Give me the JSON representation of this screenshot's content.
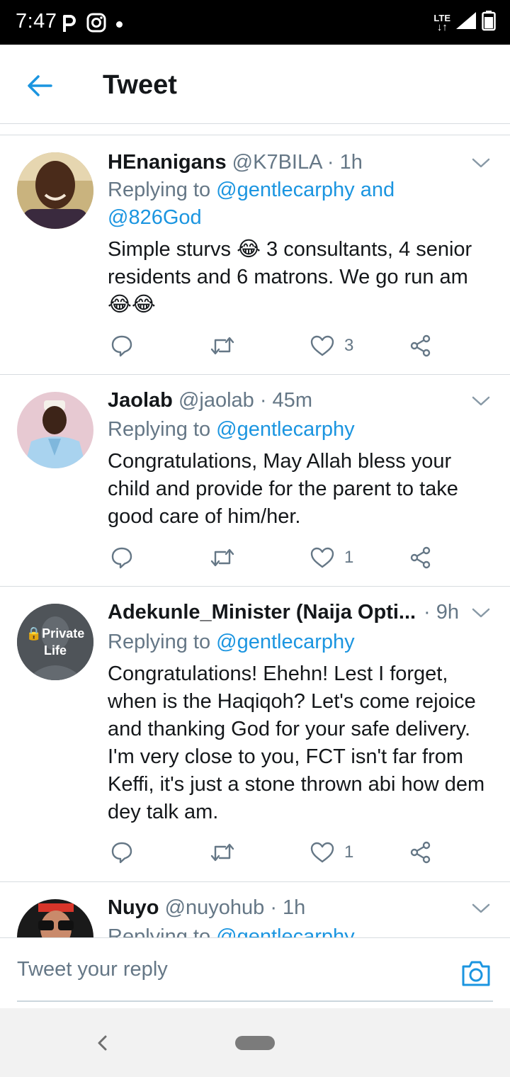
{
  "status_bar": {
    "time": "7:47",
    "network": "LTE"
  },
  "header": {
    "title": "Tweet"
  },
  "tweets": [
    {
      "name": "HEnanigans",
      "handle": "@K7BILA",
      "time": "· 1h",
      "replying_prefix": "Replying to ",
      "replying_to": "@gentlecarphy and @826God",
      "text": "Simple sturvs 😂 3 consultants, 4 senior residents and 6 matrons. We go run am 😂😂",
      "likes": "3",
      "avatar": "photo-man-smiling"
    },
    {
      "name": "Jaolab",
      "handle": "@jaolab",
      "time": "· 45m",
      "replying_prefix": "Replying to ",
      "replying_to": "@gentlecarphy",
      "text": "Congratulations, May Allah bless your child and provide for the parent to take good care of him/her.",
      "likes": "1",
      "avatar": "photo-man-cap"
    },
    {
      "name": "Adekunle_Minister (Naija Opti...",
      "handle": "",
      "time": "· 9h",
      "replying_prefix": "Replying to ",
      "replying_to": "@gentlecarphy",
      "text": "Congratulations! Ehehn! Lest I forget, when is the Haqiqoh? Let's come rejoice and thanking God for your safe delivery. I'm very close to you, FCT isn't far from Keffi, it's just a stone thrown abi how dem dey talk am.",
      "likes": "1",
      "avatar_text": [
        "🔒Private",
        "Life"
      ]
    },
    {
      "name": "Nuyo",
      "handle": "@nuyohub",
      "time": "· 1h",
      "replying_prefix": "Replying to ",
      "replying_to": "@gentlecarphy",
      "avatar": "photo-sunglasses"
    }
  ],
  "reply_bar": {
    "placeholder": "Tweet your reply"
  },
  "colors": {
    "accent": "#1b95e0",
    "muted": "#657786",
    "text": "#14171a",
    "divider": "#d7dce0"
  }
}
